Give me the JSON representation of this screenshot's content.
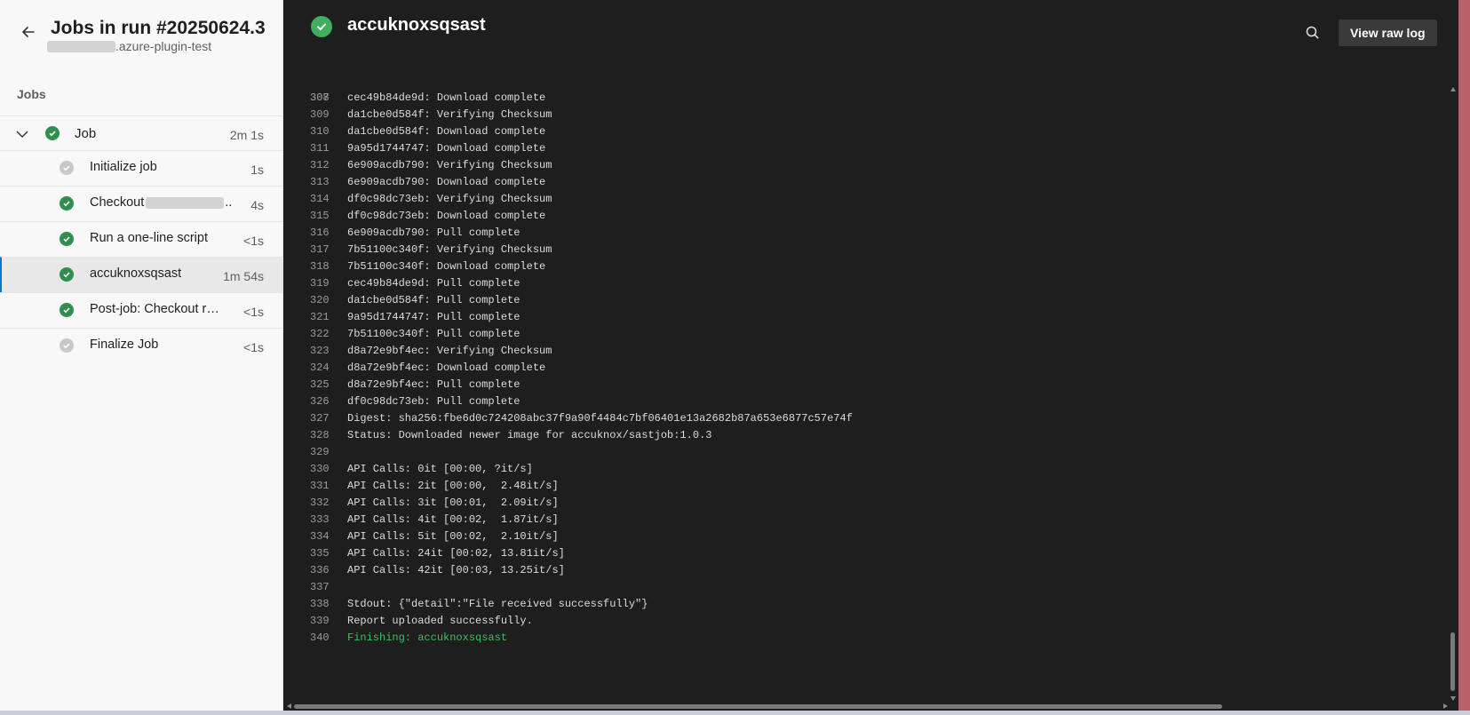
{
  "run": {
    "title": "Jobs in run #20250624.3",
    "subtitle_suffix": ".azure-plugin-test"
  },
  "jobs_header": "Jobs",
  "job": {
    "name": "Job",
    "duration": "2m 1s",
    "status": "succeeded"
  },
  "steps": [
    {
      "name": "Initialize job",
      "duration": "1s",
      "status": "skipped",
      "selected": false
    },
    {
      "name": "Checkout",
      "name_suffix": "..",
      "duration": "4s",
      "status": "succeeded",
      "selected": false
    },
    {
      "name": "Run a one-line script",
      "duration": "<1s",
      "status": "succeeded",
      "selected": false
    },
    {
      "name": "accuknoxsqsast",
      "duration": "1m 54s",
      "status": "succeeded",
      "selected": true
    },
    {
      "name": "Post-job: Checkout r…",
      "duration": "<1s",
      "status": "succeeded",
      "selected": false
    },
    {
      "name": "Finalize Job",
      "duration": "<1s",
      "status": "skipped",
      "selected": false
    }
  ],
  "log": {
    "title": "accuknoxsqsast",
    "view_raw_label": "View raw log",
    "lines": [
      {
        "n": "308",
        "text": "cec49b84de9d: Download complete"
      },
      {
        "n": "309",
        "text": "da1cbe0d584f: Verifying Checksum"
      },
      {
        "n": "310",
        "text": "da1cbe0d584f: Download complete"
      },
      {
        "n": "311",
        "text": "9a95d1744747: Download complete"
      },
      {
        "n": "312",
        "text": "6e909acdb790: Verifying Checksum"
      },
      {
        "n": "313",
        "text": "6e909acdb790: Download complete"
      },
      {
        "n": "314",
        "text": "df0c98dc73eb: Verifying Checksum"
      },
      {
        "n": "315",
        "text": "df0c98dc73eb: Download complete"
      },
      {
        "n": "316",
        "text": "6e909acdb790: Pull complete"
      },
      {
        "n": "317",
        "text": "7b51100c340f: Verifying Checksum"
      },
      {
        "n": "318",
        "text": "7b51100c340f: Download complete"
      },
      {
        "n": "319",
        "text": "cec49b84de9d: Pull complete"
      },
      {
        "n": "320",
        "text": "da1cbe0d584f: Pull complete"
      },
      {
        "n": "321",
        "text": "9a95d1744747: Pull complete"
      },
      {
        "n": "322",
        "text": "7b51100c340f: Pull complete"
      },
      {
        "n": "323",
        "text": "d8a72e9bf4ec: Verifying Checksum"
      },
      {
        "n": "324",
        "text": "d8a72e9bf4ec: Download complete"
      },
      {
        "n": "325",
        "text": "d8a72e9bf4ec: Pull complete"
      },
      {
        "n": "326",
        "text": "df0c98dc73eb: Pull complete"
      },
      {
        "n": "327",
        "text": "Digest: sha256:fbe6d0c724208abc37f9a90f4484c7bf06401e13a2682b87a653e6877c57e74f"
      },
      {
        "n": "328",
        "text": "Status: Downloaded newer image for accuknox/sastjob:1.0.3"
      },
      {
        "n": "329",
        "text": ""
      },
      {
        "n": "330",
        "text": "API Calls: 0it [00:00, ?it/s]"
      },
      {
        "n": "331",
        "text": "API Calls: 2it [00:00,  2.48it/s]"
      },
      {
        "n": "332",
        "text": "API Calls: 3it [00:01,  2.09it/s]"
      },
      {
        "n": "333",
        "text": "API Calls: 4it [00:02,  1.87it/s]"
      },
      {
        "n": "334",
        "text": "API Calls: 5it [00:02,  2.10it/s]"
      },
      {
        "n": "335",
        "text": "API Calls: 24it [00:02, 13.81it/s]"
      },
      {
        "n": "336",
        "text": "API Calls: 42it [00:03, 13.25it/s]"
      },
      {
        "n": "337",
        "text": ""
      },
      {
        "n": "338",
        "text": "Stdout: {\"detail\":\"File received successfully\"}"
      },
      {
        "n": "339",
        "text": "Report uploaded successfully."
      },
      {
        "n": "340",
        "text": "Finishing: accuknoxsqsast",
        "highlight": true
      }
    ]
  },
  "colors": {
    "success": "#2f8f4e",
    "skipped": "#c8c8c8",
    "log_background": "#1e1e1e",
    "finishing_text": "#3fbf5f",
    "selection_accent": "#0078d4"
  },
  "icons": [
    "back-arrow-icon",
    "chevron-down-icon",
    "check-circle-icon",
    "search-icon"
  ]
}
